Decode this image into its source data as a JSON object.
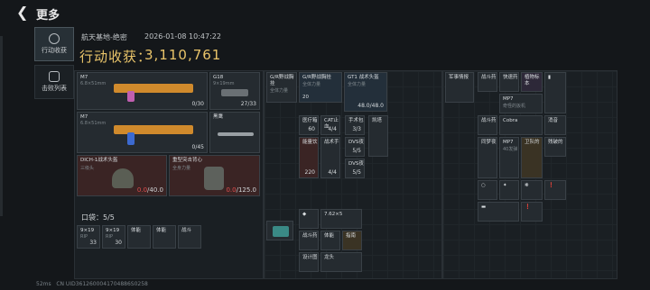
{
  "header": {
    "title": "更多"
  },
  "nav": [
    {
      "label": "行动收获",
      "active": true,
      "icon": "target-icon"
    },
    {
      "label": "击败列表",
      "active": false,
      "icon": "person-icon"
    }
  ],
  "raid": {
    "map": "航天基地-绝密",
    "datetime": "2026-01-08 10:47:22",
    "income_label": "行动收获：",
    "income_value": "3,110,761"
  },
  "weapons": [
    {
      "name": "M7",
      "sub": "6.8×51mm",
      "ammo": "0/30"
    },
    {
      "name": "M7",
      "sub": "6.8×51mm",
      "ammo": "0/45"
    }
  ],
  "sidearm": {
    "name": "G18",
    "sub": "9×19mm",
    "ammo": "27/33"
  },
  "melee": {
    "name": "黑鹰"
  },
  "helmet": {
    "name": "DICH-1战术头盔",
    "sub": "三级头",
    "hp": "0.0",
    "max": "/40.0"
  },
  "armor": {
    "name": "重型突击背心",
    "sub": "全身力量",
    "hp": "0.0",
    "max": "/125.0"
  },
  "pocket": {
    "label": "口袋：",
    "value": "5/5"
  },
  "pocket_items": [
    {
      "name": "9×19",
      "sub": "RIP",
      "count": "33"
    },
    {
      "name": "9×19",
      "sub": "RIP",
      "count": "30"
    },
    {
      "name": "体能",
      "sub": "",
      "count": ""
    },
    {
      "name": "体能",
      "sub": "",
      "count": ""
    },
    {
      "name": "战斗",
      "sub": "",
      "count": ""
    }
  ],
  "rig": [
    {
      "name": "G/R野战胸挂",
      "sub": "全体力量"
    },
    {
      "name": "G/R野战胸挂",
      "sub": "全体力量",
      "count": "20"
    },
    {
      "name": "GT1 战术头盔",
      "sub": "全体力量",
      "count": "48.0/48.0"
    }
  ],
  "rig_items": [
    {
      "name": "医疗箱",
      "count": "60"
    },
    {
      "name": "CAT止血",
      "count": "4/4"
    },
    {
      "name": "手术包",
      "count": "3/3"
    },
    {
      "name": "凯塔",
      "count": ""
    },
    {
      "name": "能量饮",
      "count": "220"
    },
    {
      "name": "战术手",
      "count": "4/4"
    },
    {
      "name": "DVS夜",
      "count": "5/5"
    },
    {
      "name": "DVS夜",
      "count": "5/5"
    }
  ],
  "bag_items": [
    {
      "name": "7.62×5",
      "count": ""
    },
    {
      "name": "战斗药",
      "count": ""
    },
    {
      "name": "体能",
      "count": ""
    },
    {
      "name": "指南",
      "count": ""
    },
    {
      "name": "战斗药",
      "count": ""
    },
    {
      "name": "设计图",
      "count": ""
    },
    {
      "name": "龙头",
      "count": ""
    }
  ],
  "loot": [
    {
      "name": "军事情报"
    },
    {
      "name": "战斗药"
    },
    {
      "name": "快速药"
    },
    {
      "name": "植物标本"
    },
    {
      "name": "MP7",
      "sub": "奇怪的扳机"
    },
    {
      "name": "战斗药"
    },
    {
      "name": "Cobra"
    },
    {
      "name": "消音"
    },
    {
      "name": "同梦夜"
    },
    {
      "name": "MP7",
      "sub": "40发弹"
    },
    {
      "name": "卫队的"
    },
    {
      "name": "残破的"
    }
  ],
  "footer": {
    "ping": "52ms",
    "uid": "CN UID3612600041704886S0258"
  }
}
